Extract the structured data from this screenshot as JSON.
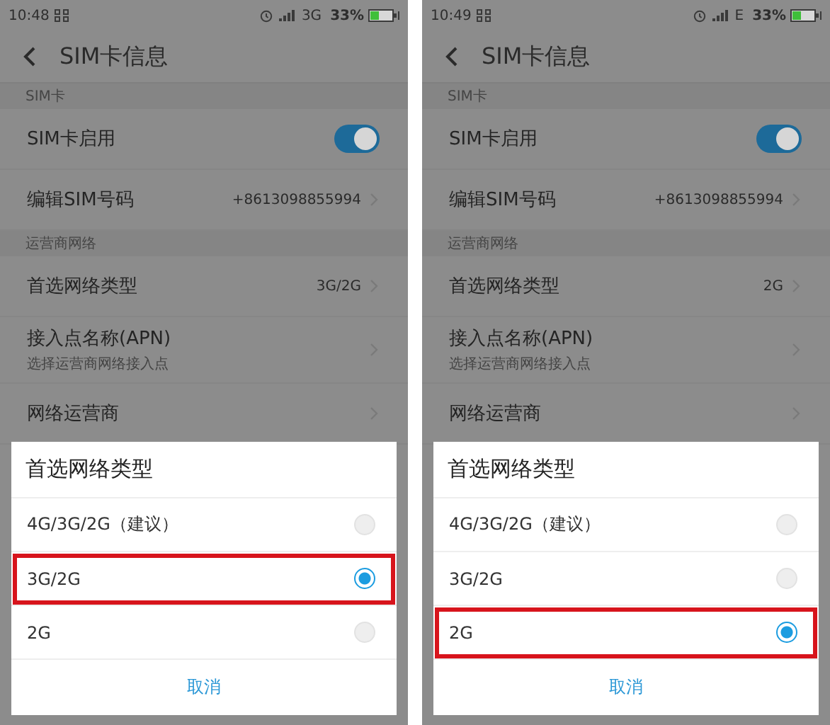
{
  "screens": [
    {
      "status_bar": {
        "time": "10:48",
        "network": "3G",
        "battery": "33%"
      },
      "title": "SIM卡信息",
      "sections": [
        {
          "header": "SIM卡",
          "rows": [
            {
              "kind": "toggle",
              "label": "SIM卡启用",
              "on": true
            },
            {
              "kind": "link",
              "label": "编辑SIM号码",
              "value": "+8613098855994"
            }
          ]
        },
        {
          "header": "运营商网络",
          "rows": [
            {
              "kind": "link",
              "label": "首选网络类型",
              "value": "3G/2G"
            },
            {
              "kind": "link",
              "label": "接入点名称(APN)",
              "subtitle": "选择运营商网络接入点"
            },
            {
              "kind": "link",
              "label": "网络运营商"
            }
          ]
        }
      ],
      "dialog": {
        "title": "首选网络类型",
        "options": [
          {
            "label": "4G/3G/2G（建议）",
            "selected": false,
            "highlighted": false
          },
          {
            "label": "3G/2G",
            "selected": true,
            "highlighted": true
          },
          {
            "label": "2G",
            "selected": false,
            "highlighted": false
          }
        ],
        "cancel": "取消"
      }
    },
    {
      "status_bar": {
        "time": "10:49",
        "network": "E",
        "battery": "33%"
      },
      "title": "SIM卡信息",
      "sections": [
        {
          "header": "SIM卡",
          "rows": [
            {
              "kind": "toggle",
              "label": "SIM卡启用",
              "on": true
            },
            {
              "kind": "link",
              "label": "编辑SIM号码",
              "value": "+8613098855994"
            }
          ]
        },
        {
          "header": "运营商网络",
          "rows": [
            {
              "kind": "link",
              "label": "首选网络类型",
              "value": "2G"
            },
            {
              "kind": "link",
              "label": "接入点名称(APN)",
              "subtitle": "选择运营商网络接入点"
            },
            {
              "kind": "link",
              "label": "网络运营商"
            }
          ]
        }
      ],
      "dialog": {
        "title": "首选网络类型",
        "options": [
          {
            "label": "4G/3G/2G（建议）",
            "selected": false,
            "highlighted": false
          },
          {
            "label": "3G/2G",
            "selected": false,
            "highlighted": false
          },
          {
            "label": "2G",
            "selected": true,
            "highlighted": true
          }
        ],
        "cancel": "取消"
      }
    }
  ]
}
